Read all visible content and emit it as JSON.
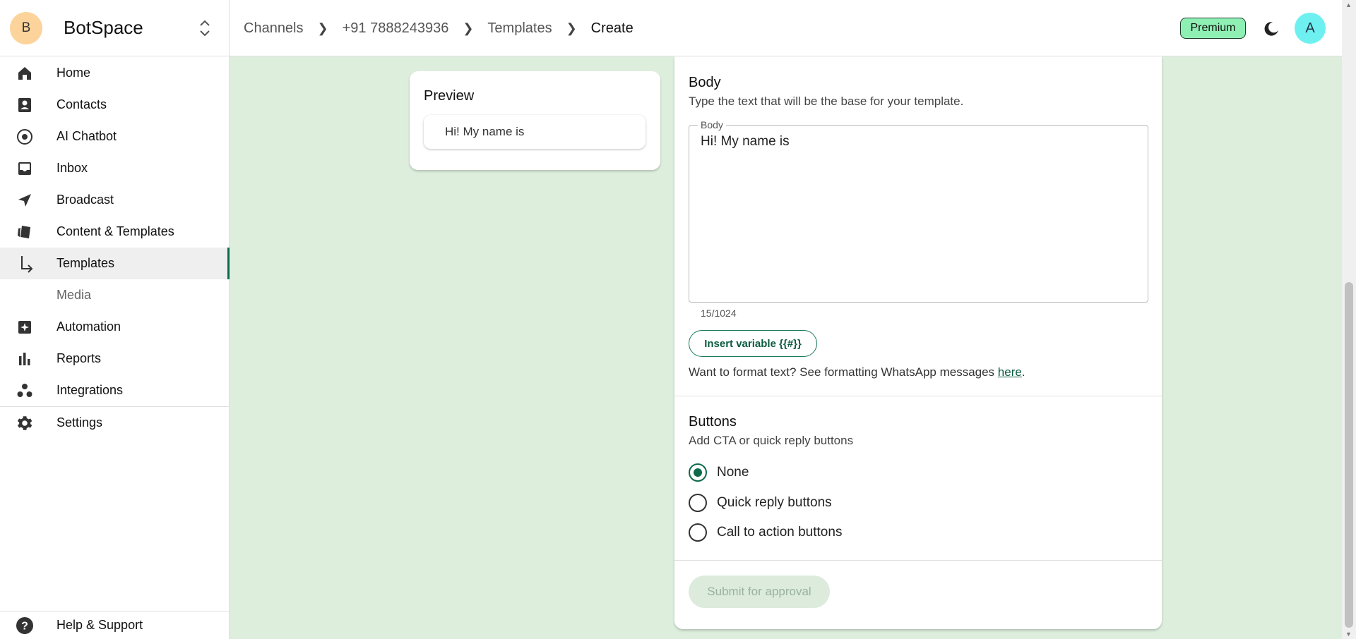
{
  "brand": {
    "initial": "B",
    "name": "BotSpace"
  },
  "sidebar": {
    "items": [
      {
        "label": "Home",
        "icon": "home-icon"
      },
      {
        "label": "Contacts",
        "icon": "contacts-icon"
      },
      {
        "label": "AI Chatbot",
        "icon": "chatbot-icon"
      },
      {
        "label": "Inbox",
        "icon": "inbox-icon"
      },
      {
        "label": "Broadcast",
        "icon": "broadcast-icon"
      },
      {
        "label": "Content & Templates",
        "icon": "content-icon"
      },
      {
        "label": "Templates",
        "icon": "subitem-arrow-icon",
        "active": true
      },
      {
        "label": "Media"
      },
      {
        "label": "Automation",
        "icon": "automation-icon"
      },
      {
        "label": "Reports",
        "icon": "reports-icon"
      },
      {
        "label": "Integrations",
        "icon": "integrations-icon"
      },
      {
        "label": "Settings",
        "icon": "settings-icon"
      }
    ],
    "help_label": "Help & Support"
  },
  "header": {
    "breadcrumb": [
      "Channels",
      "+91 7888243936",
      "Templates",
      "Create"
    ],
    "premium_label": "Premium",
    "user_initial": "A"
  },
  "preview": {
    "title": "Preview",
    "message": "Hi! My name is"
  },
  "body_section": {
    "title": "Body",
    "description": "Type the text that will be the base for your template.",
    "field_label": "Body",
    "value": "Hi! My name is",
    "char_count": "15/1024",
    "insert_variable_label": "Insert variable {{#}}",
    "format_hint": "Want to format text? See formatting WhatsApp messages ",
    "format_link": "here",
    "format_suffix": "."
  },
  "buttons_section": {
    "title": "Buttons",
    "description": "Add CTA or quick reply buttons",
    "options": [
      "None",
      "Quick reply buttons",
      "Call to action buttons"
    ],
    "selected": "None"
  },
  "submit_label": "Submit for approval",
  "colors": {
    "accent": "#0d6b4a",
    "background": "#ddeedd",
    "premium": "#8ff0b4"
  }
}
